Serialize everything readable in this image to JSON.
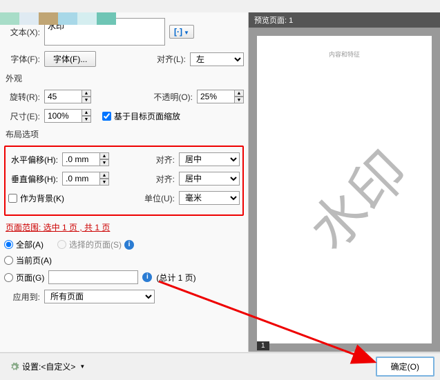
{
  "top_section": {
    "text_label": "文本(X):",
    "text_value": "水印",
    "font_label": "字体(F):",
    "font_button": "字体(F)...",
    "align_label": "对齐(L):",
    "align_value": "左"
  },
  "appearance": {
    "section_title": "外观",
    "rotate_label": "旋转(R):",
    "rotate_value": "45",
    "opacity_label": "不透明(O):",
    "opacity_value": "25%",
    "size_label": "尺寸(E):",
    "size_value": "100%",
    "scale_checkbox_label": "基于目标页面缩放"
  },
  "layout": {
    "section_title": "布局选项",
    "hoffset_label": "水平偏移(H):",
    "hoffset_value": ".0 mm",
    "voffset_label": "垂直偏移(H):",
    "voffset_value": ".0 mm",
    "align_label": "对齐:",
    "halign_value": "居中",
    "valign_value": "居中",
    "as_bg_label": "作为背景(K)",
    "unit_label": "单位(U):",
    "unit_value": "毫米"
  },
  "page_range": {
    "section_title": "页面范围: 选中 1 页 , 共 1 页",
    "all_label": "全部(A)",
    "selected_label": "选择的页面(S)",
    "current_label": "当前页(A)",
    "pages_label": "页面(G)",
    "total_text": "(总计 1 页)",
    "apply_label": "应用到:",
    "apply_value": "所有页面"
  },
  "preview": {
    "header": "预览页面: 1",
    "small_text": "内容和特征",
    "watermark_text": "水印",
    "page_num": "1"
  },
  "bottom": {
    "settings_label": "设置:<自定义>",
    "ok_button": "确定(O)"
  }
}
